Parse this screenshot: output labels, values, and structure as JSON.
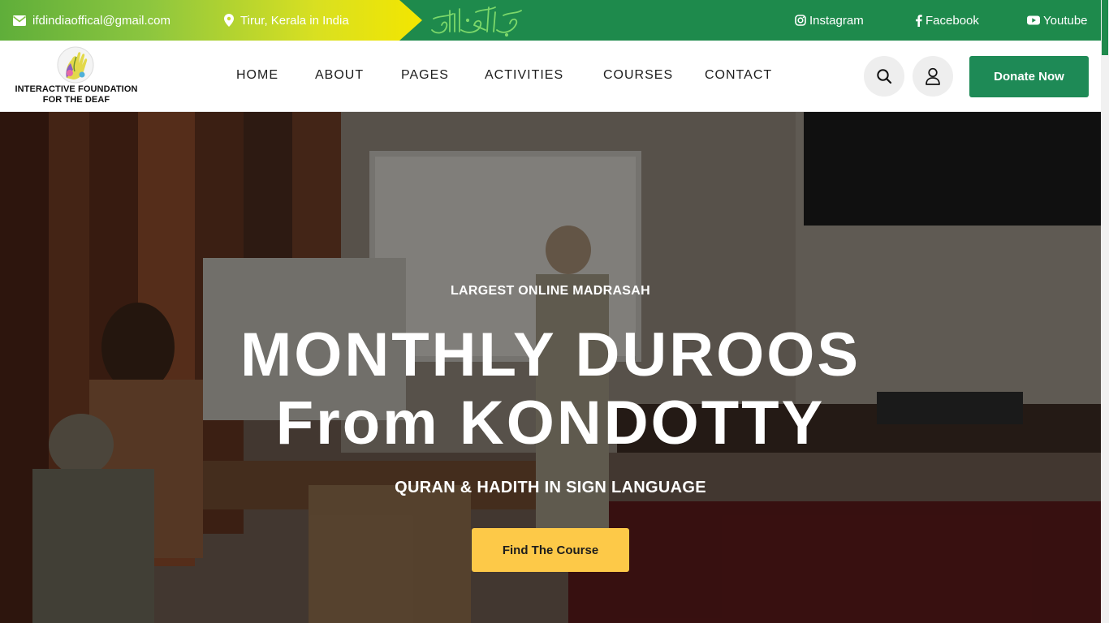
{
  "topbar": {
    "email": "ifdindiaoffical@gmail.com",
    "location": "Tirur, Kerala in India",
    "calligraphy_alt": "بسم الله الرحمن الرحيم",
    "socials": [
      {
        "icon": "instagram-icon",
        "label": "Instagram"
      },
      {
        "icon": "facebook-icon",
        "label": "Facebook"
      },
      {
        "icon": "youtube-icon",
        "label": "Youtube"
      }
    ]
  },
  "header": {
    "logo_line1": "INTERACTIVE FOUNDATION",
    "logo_line2": "FOR THE DEAF",
    "nav": [
      "HOME",
      "ABOUT",
      "PAGES",
      "ACTIVITIES",
      "COURSES",
      "CONTACT"
    ],
    "search_icon": "search-icon",
    "user_icon": "user-icon",
    "donate_label": "Donate Now"
  },
  "hero": {
    "eyebrow": "LARGEST ONLINE MADRASAH",
    "title_line1": "MONTHLY DUROOS",
    "title_line2": "From KONDOTTY",
    "subtitle": "QURAN & HADITH IN SIGN LANGUAGE",
    "cta_label": "Find The Course"
  },
  "colors": {
    "brand_green": "#1e8a4c",
    "donate_green": "#1e8a56",
    "accent_yellow": "#fdc948",
    "gradient_start": "#5fae3a",
    "gradient_end": "#f3e600"
  }
}
